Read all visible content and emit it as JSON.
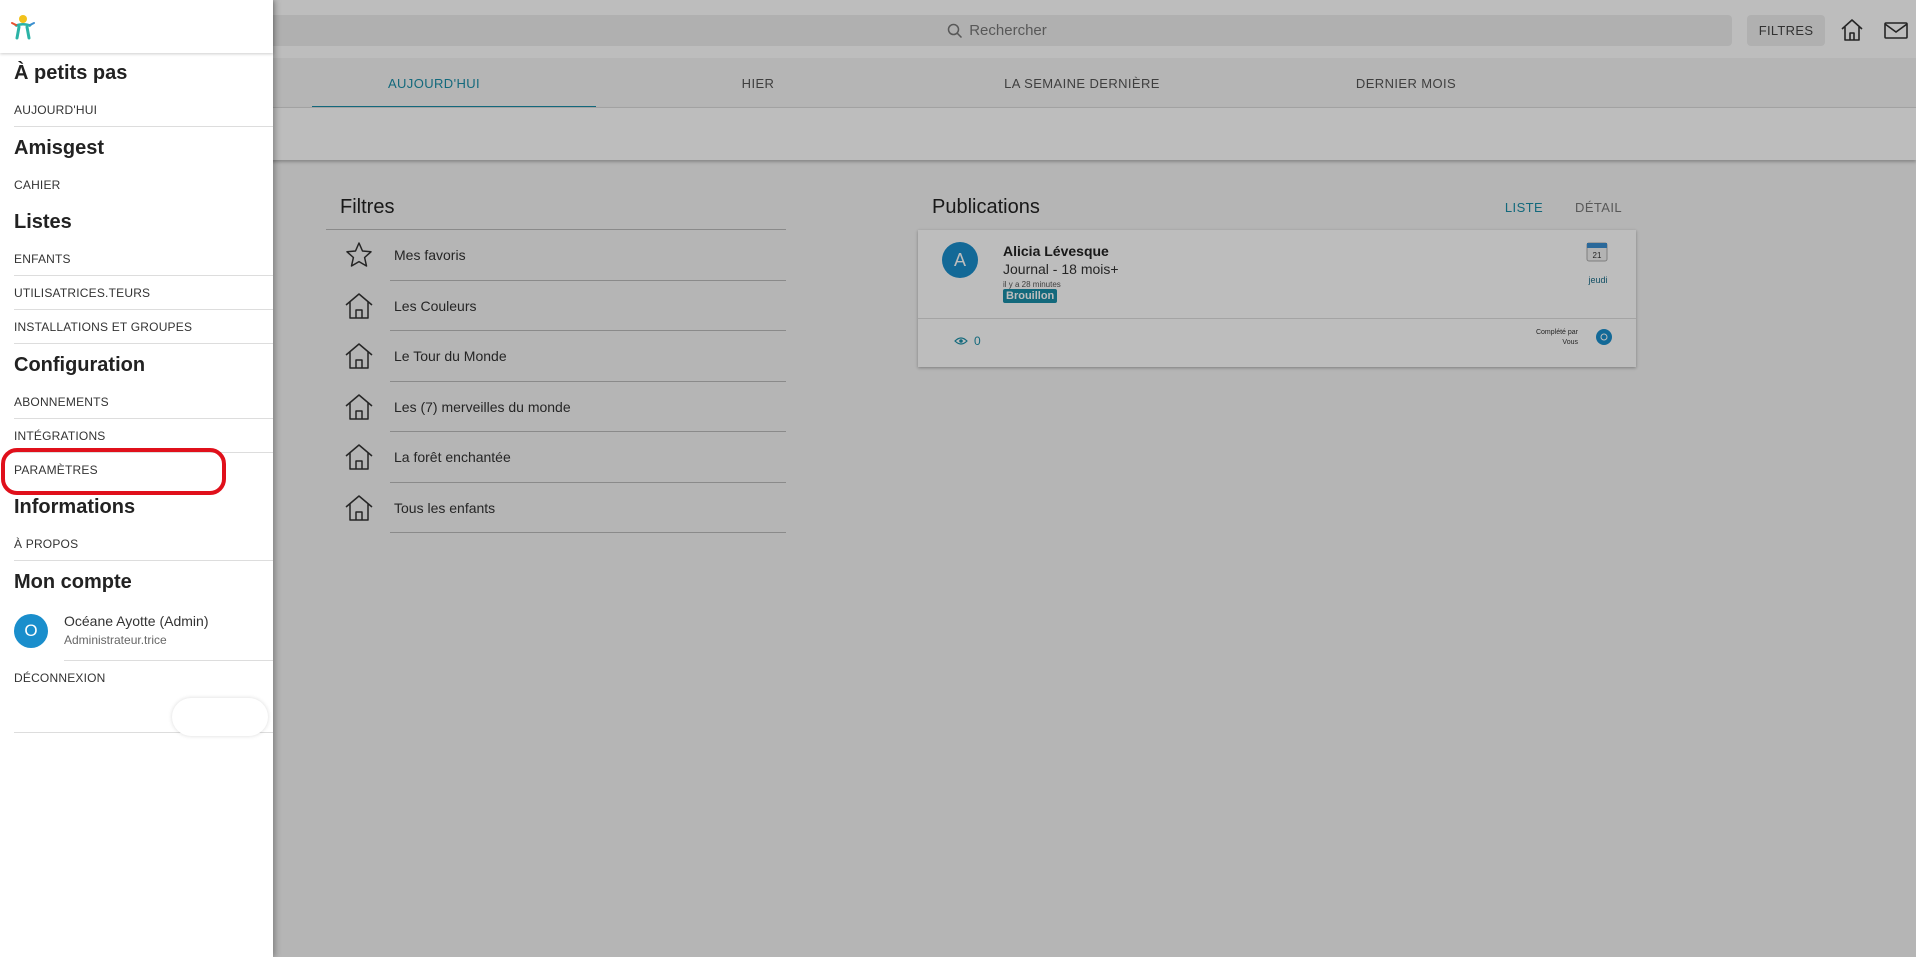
{
  "search": {
    "placeholder": "Rechercher"
  },
  "header": {
    "filters_label": "FILTRES"
  },
  "tabs": [
    {
      "label": "AUJOURD'HUI",
      "active": true
    },
    {
      "label": "HIER"
    },
    {
      "label": "LA SEMAINE DERNIÈRE"
    },
    {
      "label": "DERNIER MOIS"
    }
  ],
  "filters": {
    "title": "Filtres",
    "items": [
      {
        "label": "Mes favoris",
        "icon": "star-icon"
      },
      {
        "label": "Les Couleurs",
        "icon": "home-icon"
      },
      {
        "label": "Le Tour du Monde",
        "icon": "home-icon"
      },
      {
        "label": "Les (7) merveilles du monde",
        "icon": "home-icon"
      },
      {
        "label": "La forêt enchantée",
        "icon": "home-icon"
      },
      {
        "label": "Tous les enfants",
        "icon": "home-icon"
      }
    ]
  },
  "publications": {
    "title": "Publications",
    "view_list": "LISTE",
    "view_detail": "DÉTAIL",
    "card": {
      "avatar_letter": "A",
      "author": "Alicia Lévesque",
      "journal": "Journal - 18 mois+",
      "ago": "il y a 28 minutes",
      "badge": "Brouillon",
      "calendar_day": "21",
      "weekday": "jeudi",
      "views": "0",
      "completed_line1": "Complété par",
      "completed_line2": "Vous"
    }
  },
  "drawer": {
    "sections": [
      {
        "title": "À petits pas",
        "items": [
          "AUJOURD'HUI"
        ]
      },
      {
        "title": "Amisgest",
        "items": [
          "CAHIER"
        ]
      },
      {
        "title": "Listes",
        "items": [
          "ENFANTS",
          "UTILISATRICES.TEURS",
          "INSTALLATIONS ET GROUPES"
        ]
      },
      {
        "title": "Configuration",
        "items": [
          "ABONNEMENTS",
          "INTÉGRATIONS",
          "PARAMÈTRES"
        ]
      },
      {
        "title": "Informations",
        "items": [
          "À PROPOS"
        ]
      },
      {
        "title": "Mon compte",
        "items": []
      }
    ],
    "account": {
      "avatar_letter": "O",
      "name": "Océane Ayotte (Admin)",
      "role": "Administrateur.trice"
    },
    "logout": "DÉCONNEXION"
  },
  "colors": {
    "accent": "#1a8ea8",
    "avatar": "#1a8ecc",
    "highlight": "#e0101b"
  }
}
